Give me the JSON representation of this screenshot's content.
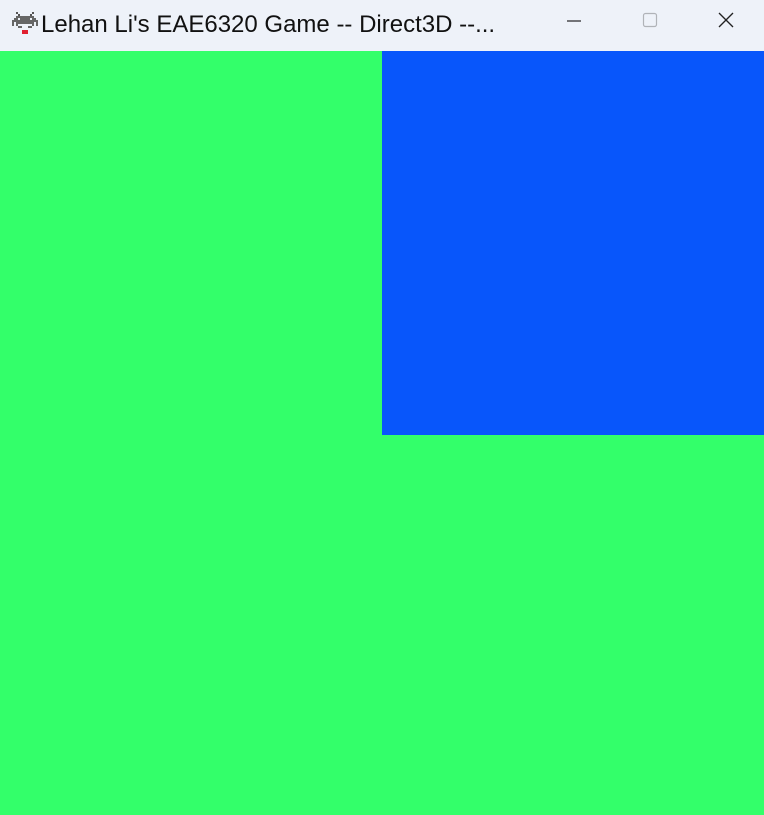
{
  "window": {
    "title": "Lehan Li's EAE6320 Game -- Direct3D --...",
    "app_icon": "space-invader-icon",
    "caption_buttons": {
      "minimize_icon": "minimize-icon",
      "maximize_icon": "maximize-icon",
      "close_icon": "close-icon"
    }
  },
  "scene": {
    "clear_color": "#33ff6a",
    "quad_color": "#0856fb"
  }
}
